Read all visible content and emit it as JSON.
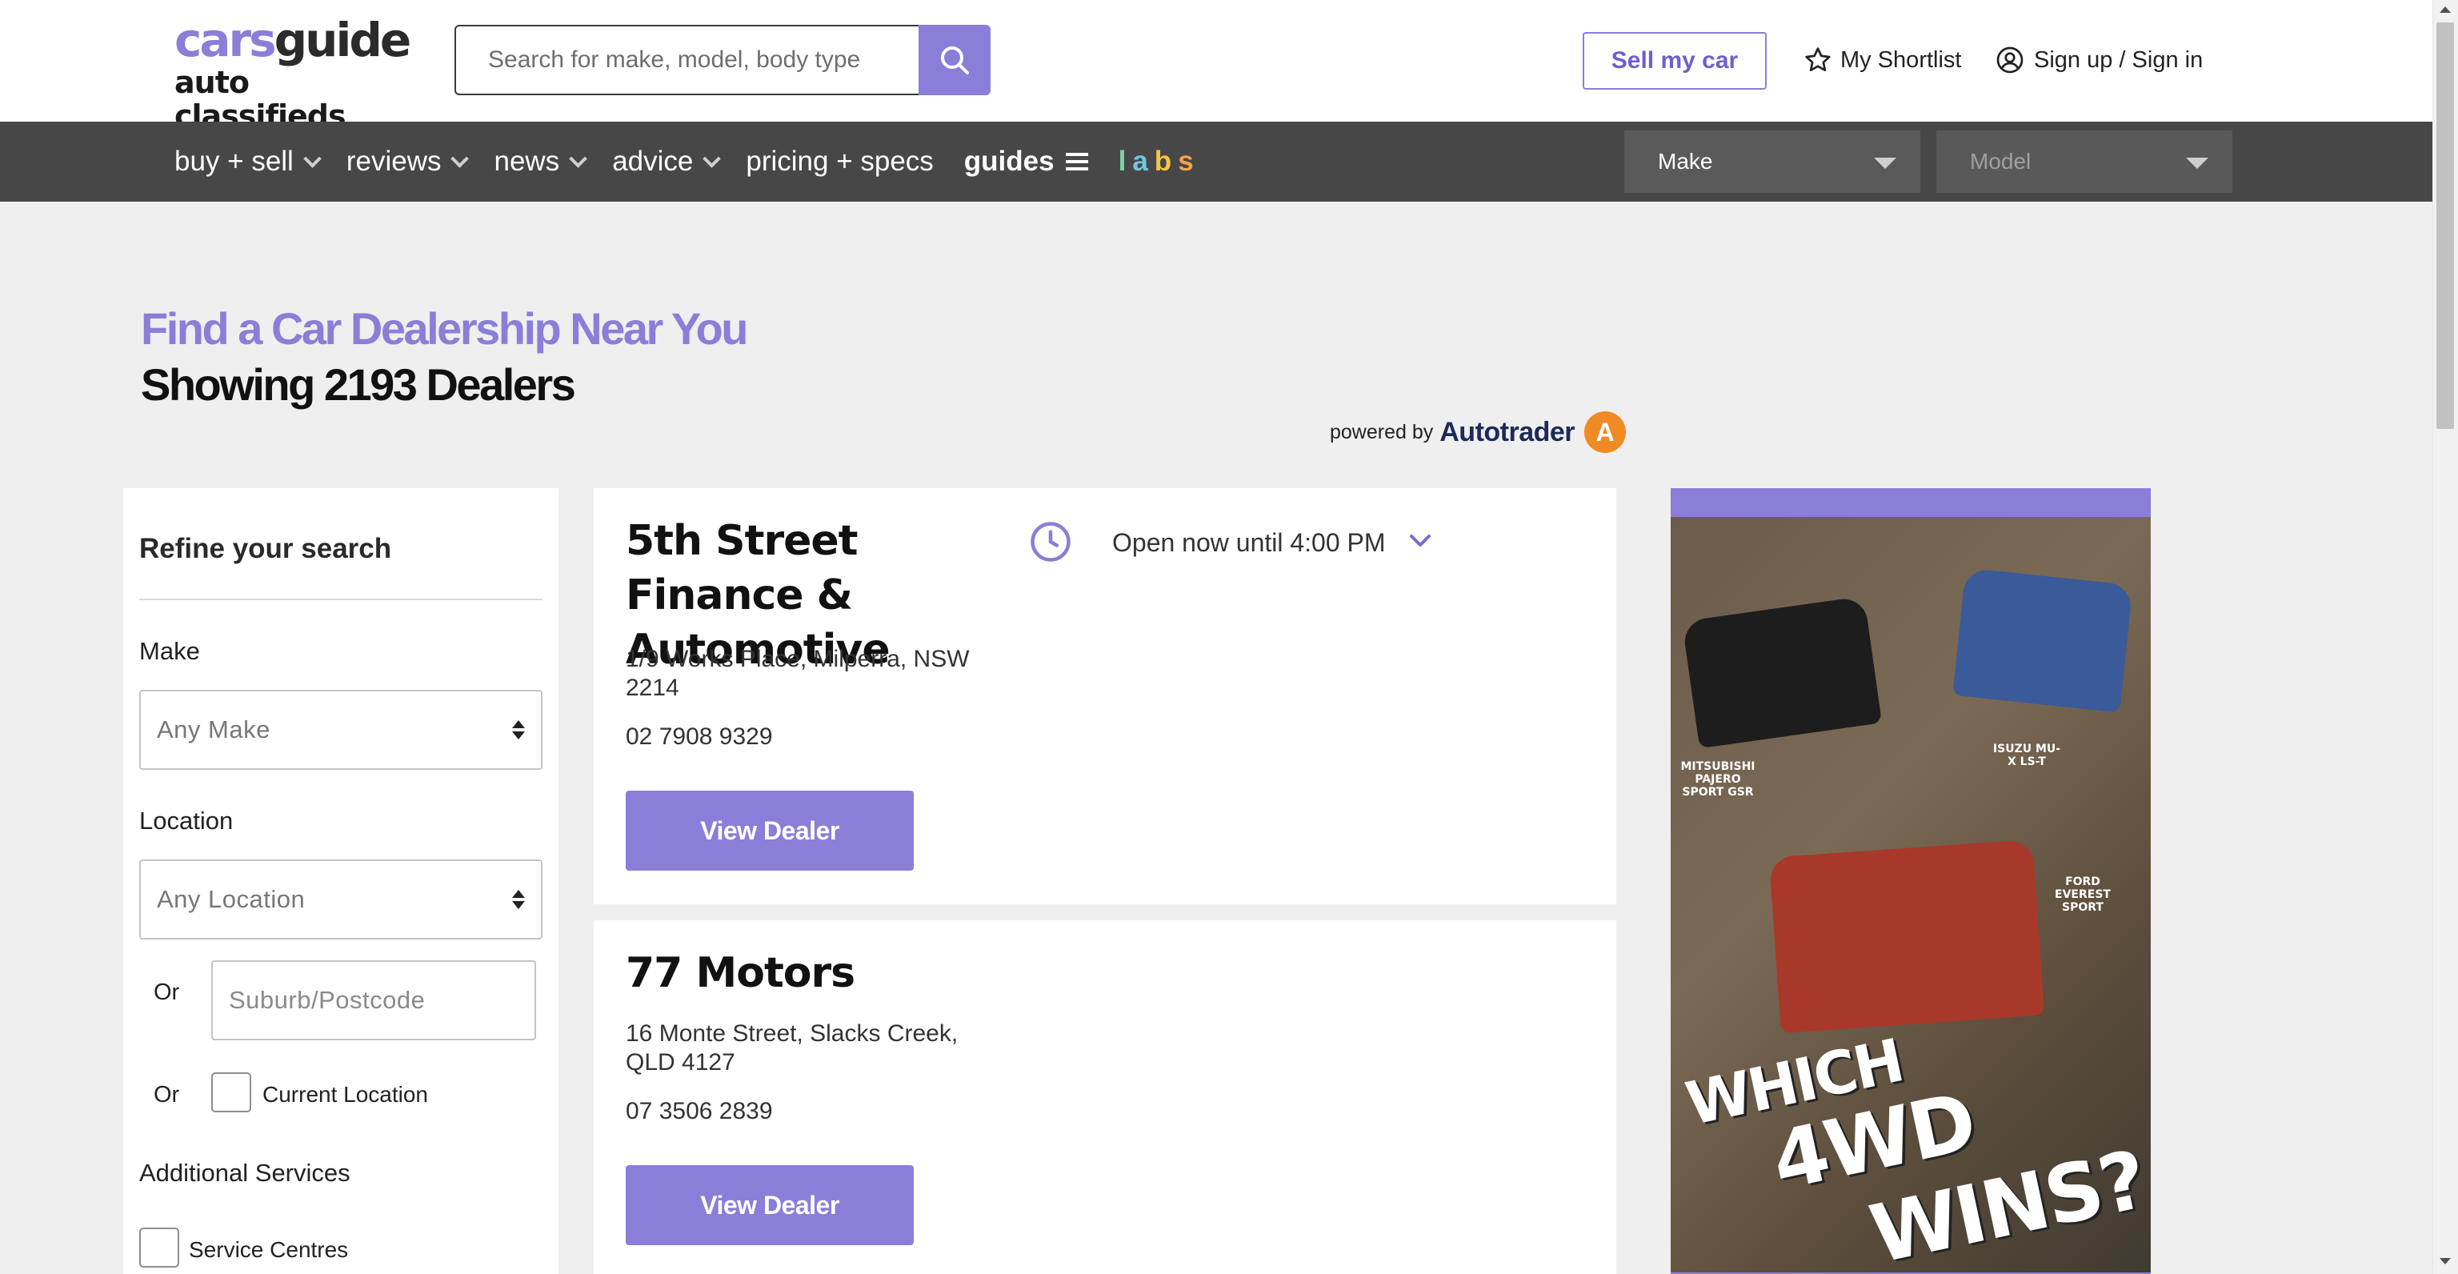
{
  "header": {
    "logo_top_a": "cars",
    "logo_top_b": "guide",
    "logo_bottom": "auto classifieds",
    "search_placeholder": "Search for make, model, body type",
    "sell_label": "Sell my car",
    "shortlist_label": "My Shortlist",
    "signin_label": "Sign up / Sign in"
  },
  "nav": {
    "items": [
      {
        "label": "buy + sell"
      },
      {
        "label": "reviews"
      },
      {
        "label": "news"
      },
      {
        "label": "advice"
      },
      {
        "label": "pricing + specs"
      },
      {
        "label": "guides"
      }
    ],
    "labs": [
      "l",
      "a",
      "b",
      "s"
    ],
    "make_select": "Make",
    "model_select": "Model"
  },
  "page": {
    "title": "Find a Car Dealership Near You",
    "subtitle": "Showing 2193 Dealers",
    "powered_by": "powered by",
    "autotrader": "Autotrader"
  },
  "sidebar": {
    "title": "Refine your search",
    "make_label": "Make",
    "make_value": "Any Make",
    "location_label": "Location",
    "location_value": "Any Location",
    "or1": "Or",
    "suburb_placeholder": "Suburb/Postcode",
    "or2": "Or",
    "current_location": "Current Location",
    "additional_services": "Additional Services",
    "service_centres": "Service Centres"
  },
  "dealers": [
    {
      "name": "5th Street Finance & Automotive",
      "open": "Open now until 4:00 PM",
      "address": "1/9 Works Place, Milperra, NSW 2214",
      "phone": "02 7908 9329",
      "button": "View Dealer"
    },
    {
      "name": "77 Motors",
      "address": "16 Monte Street, Slacks Creek, QLD 4127",
      "phone": "07 3506 2839",
      "button": "View Dealer"
    }
  ],
  "ad": {
    "car1": "MITSUBISHI PAJERO SPORT GSR",
    "car2": "ISUZU MU-X LS-T",
    "car3": "FORD EVEREST SPORT",
    "line1": "WHICH",
    "line2": "4WD",
    "line3": "WINS?"
  },
  "colors": {
    "accent": "#8b7ed8",
    "nav_bg": "#474747",
    "page_bg": "#efefef"
  },
  "icons": [
    "search-icon",
    "star-icon",
    "user-icon",
    "clock-icon",
    "chevron-down-icon",
    "menu-icon"
  ]
}
